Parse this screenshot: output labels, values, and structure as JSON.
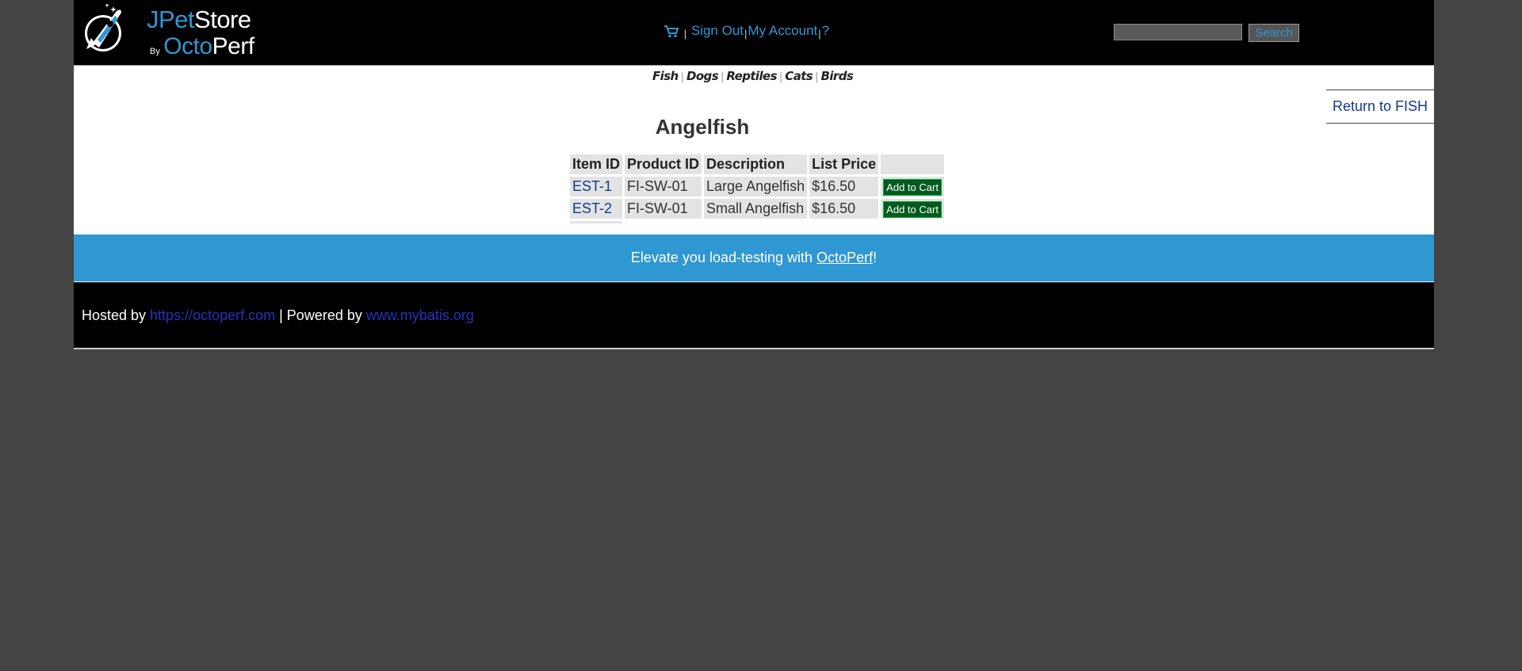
{
  "header": {
    "logo": {
      "jpet": "JPet",
      "store": "Store",
      "by": "By",
      "octo": "Octo",
      "perf": "Perf"
    },
    "menu": {
      "cart_icon": "cart-icon",
      "sep": "|",
      "sign_out": "Sign Out",
      "my_account": "My Account",
      "help": "?"
    },
    "search": {
      "value": "",
      "button_label": "Search"
    }
  },
  "quicklinks": [
    "Fish",
    "Dogs",
    "Reptiles",
    "Cats",
    "Birds"
  ],
  "quicklink_separator": "|",
  "back_link": "Return to FISH",
  "product": {
    "title": "Angelfish",
    "columns": [
      "Item ID",
      "Product ID",
      "Description",
      "List Price",
      ""
    ],
    "rows": [
      {
        "item_id": "EST-1",
        "product_id": "FI-SW-01",
        "description": "Large Angelfish",
        "price": "$16.50",
        "action": "Add to Cart"
      },
      {
        "item_id": "EST-2",
        "product_id": "FI-SW-01",
        "description": "Small Angelfish",
        "price": "$16.50",
        "action": "Add to Cart"
      }
    ]
  },
  "banner": {
    "prefix": "Elevate you load-testing with ",
    "link": "OctoPerf",
    "suffix": "!"
  },
  "footer": {
    "hosted_by": "Hosted by ",
    "hosted_link": "https://octoperf.com",
    "powered_by": " | Powered by ",
    "powered_link": "www.mybatis.org"
  },
  "colors": {
    "accent": "#2f97d2",
    "header_bg": "#000000",
    "page_bg": "#444444",
    "add_button": "#045a1e",
    "link": "#123a8c"
  }
}
